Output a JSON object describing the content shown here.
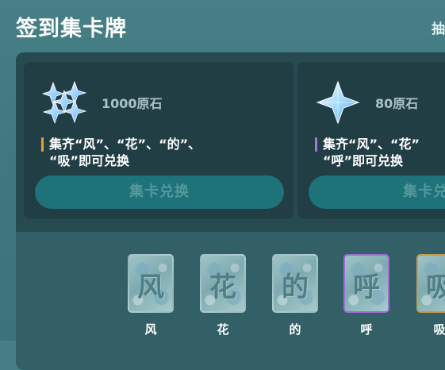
{
  "header": {
    "title": "签到集卡牌",
    "right_link": "抽"
  },
  "rewards": [
    {
      "amount": "1000原石",
      "description_line1": "集齐“风”、“花”、“的”、",
      "description_line2": "“吸”即可兑换",
      "accent_color": "#e0a23a",
      "button_label": "集卡兑换",
      "icon": "primogem-cluster-icon"
    },
    {
      "amount": "80原石",
      "description_line1": "集齐“风”、“花”",
      "description_line2": "“呼”即可兑换",
      "accent_color": "#a774e0",
      "button_label": "集卡兑换",
      "icon": "primogem-icon"
    }
  ],
  "cards": [
    {
      "char": "风",
      "label": "风"
    },
    {
      "char": "花",
      "label": "花"
    },
    {
      "char": "的",
      "label": "的"
    },
    {
      "char": "呼",
      "label": "呼"
    },
    {
      "char": "吸",
      "label": "吸"
    }
  ]
}
